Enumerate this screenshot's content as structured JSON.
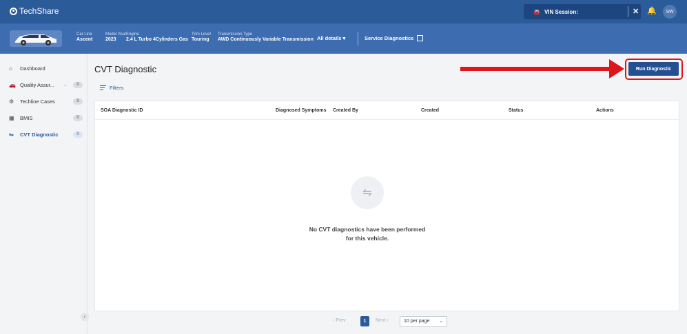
{
  "topbar": {
    "brand": "TechShare",
    "vin_label": "VIN Session:",
    "vin_icon": "car-icon",
    "close_icon": "close-icon",
    "bell_icon": "bell-icon",
    "avatar_initials": "SW"
  },
  "vehicle": {
    "car_line_label": "Car Line",
    "car_line": "Ascent",
    "model_year_label": "Model Year",
    "model_year": "2023",
    "engine_label": "Engine",
    "engine": "2.4 L Turbo 4Cylinders Gas",
    "trim_label": "Trim Level",
    "trim": "Touring",
    "transmission_label": "Transmission Type",
    "transmission": "AWD Continuously Variable Transmission",
    "all_details": "All details ▾",
    "service_diagnostics": "Service Diagnostics"
  },
  "sidebar": {
    "items": [
      {
        "label": "Dashboard",
        "icon": "home-icon",
        "badge": ""
      },
      {
        "label": "Quality Assur...",
        "icon": "car-icon",
        "badge": "0"
      },
      {
        "label": "Techline Cases",
        "icon": "support-icon",
        "badge": "0"
      },
      {
        "label": "BMIS",
        "icon": "grid-icon",
        "badge": "0"
      },
      {
        "label": "CVT Diagnostic",
        "icon": "diagnostic-icon",
        "badge": "0"
      }
    ],
    "collapse_glyph": "‹"
  },
  "main": {
    "title": "CVT Diagnostic",
    "filters_label": "Filters",
    "run_button": "Run Diagnostic",
    "columns": [
      "SOA Diagnostic ID",
      "Diagnosed Symptoms",
      "Created By",
      "Created",
      "Status",
      "Actions"
    ],
    "empty_message": "No CVT diagnostics have been performed for this vehicle.",
    "empty_icon": "diagnostic-icon"
  },
  "pagination": {
    "prev": "‹ Prev",
    "page": "1",
    "next": "Next ›",
    "per_page": "10 per page"
  },
  "colors": {
    "topbar": "#2c5b9a",
    "vehiclebar": "#3d6cb1",
    "accent": "#244f93",
    "annotation_red": "#e0141b"
  }
}
